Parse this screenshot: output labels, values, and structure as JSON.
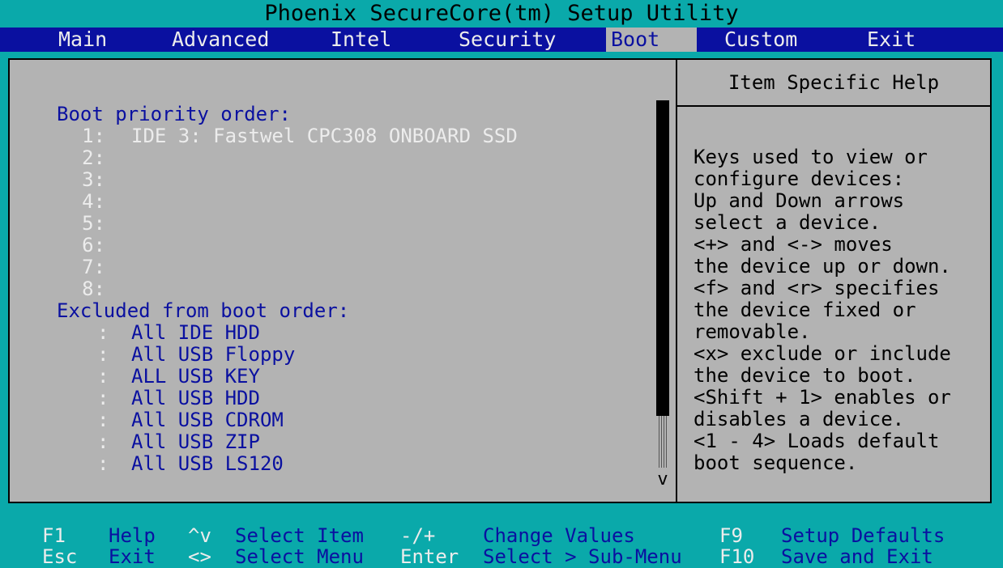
{
  "window": {
    "title": "Phoenix SecureCore(tm) Setup Utility"
  },
  "menu": {
    "items": [
      {
        "label": "Main"
      },
      {
        "label": "Advanced"
      },
      {
        "label": "Intel"
      },
      {
        "label": "Security"
      },
      {
        "label": "Boot",
        "active": true
      },
      {
        "label": "Custom"
      },
      {
        "label": "Exit"
      }
    ]
  },
  "boot": {
    "priority_heading": "Boot priority order:",
    "priority": [
      {
        "num": "1:",
        "device": "IDE 3: Fastwel CPC308 ONBOARD SSD"
      },
      {
        "num": "2:",
        "device": ""
      },
      {
        "num": "3:",
        "device": ""
      },
      {
        "num": "4:",
        "device": ""
      },
      {
        "num": "5:",
        "device": ""
      },
      {
        "num": "6:",
        "device": ""
      },
      {
        "num": "7:",
        "device": ""
      },
      {
        "num": "8:",
        "device": ""
      }
    ],
    "excluded_heading": "Excluded from boot order:",
    "excluded": [
      {
        "sep": ":",
        "device": "All IDE HDD"
      },
      {
        "sep": ":",
        "device": "All USB Floppy"
      },
      {
        "sep": ":",
        "device": "ALL USB KEY"
      },
      {
        "sep": ":",
        "device": "All USB HDD"
      },
      {
        "sep": ":",
        "device": "All USB CDROM"
      },
      {
        "sep": ":",
        "device": "All USB ZIP"
      },
      {
        "sep": ":",
        "device": "All USB LS120"
      }
    ],
    "scroll_arrow": "v"
  },
  "help": {
    "title": "Item Specific Help",
    "lines": [
      "Keys used to view or",
      "configure devices:",
      "Up and Down arrows",
      "select a device.",
      "<+> and <-> moves",
      "the device up or down.",
      "<f> and <r> specifies",
      "the device fixed or",
      "removable.",
      "<x> exclude or include",
      "the device to boot.",
      "<Shift + 1> enables or",
      "disables a device.",
      "<1 - 4> Loads default",
      "boot sequence."
    ]
  },
  "footer": {
    "row1": [
      {
        "key": "F1",
        "desc": "Help"
      },
      {
        "key": "^v",
        "desc": "Select Item"
      },
      {
        "key": "-/+",
        "desc": "Change Values"
      },
      {
        "key": "F9",
        "desc": "Setup Defaults"
      }
    ],
    "row2": [
      {
        "key": "Esc",
        "desc": "Exit"
      },
      {
        "key": "<>",
        "desc": "Select Menu"
      },
      {
        "key": "Enter",
        "desc": "Select > Sub-Menu"
      },
      {
        "key": "F10",
        "desc": "Save and Exit"
      }
    ]
  },
  "colors": {
    "background": "#0aa9aa",
    "menu_bar": "#0a10a0",
    "panel": "#b3b3b3",
    "highlight_text": "#ececec",
    "accent_text": "#0a10a0"
  }
}
